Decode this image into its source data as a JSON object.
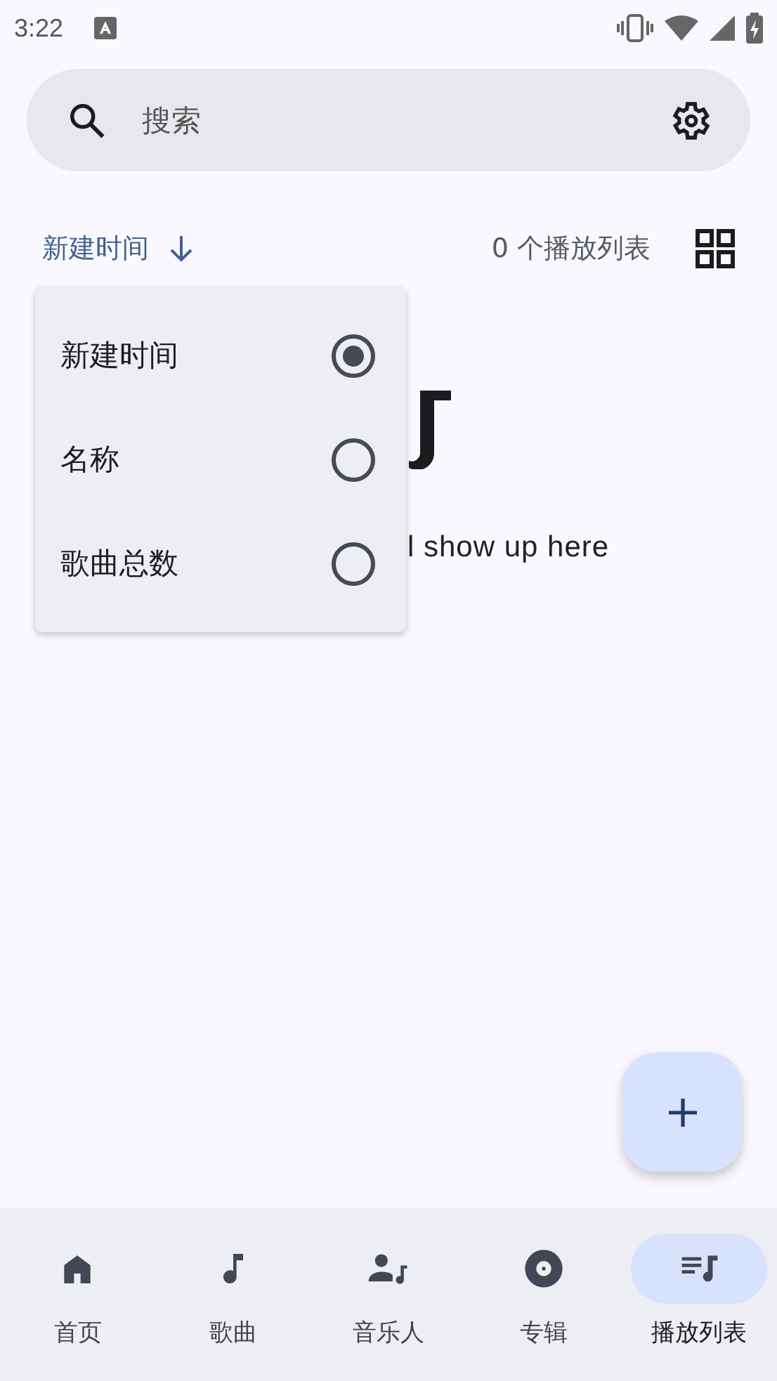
{
  "status_bar": {
    "time": "3:22"
  },
  "search": {
    "placeholder": "搜索"
  },
  "sort": {
    "label": "新建时间",
    "count": "0 个播放列表"
  },
  "sort_menu": [
    {
      "label": "新建时间",
      "selected": true
    },
    {
      "label": "名称",
      "selected": false
    },
    {
      "label": "歌曲总数",
      "selected": false
    }
  ],
  "empty_state": {
    "message": "l show up here"
  },
  "nav": [
    {
      "label": "首页",
      "kind": "home",
      "selected": false
    },
    {
      "label": "歌曲",
      "kind": "note",
      "selected": false
    },
    {
      "label": "音乐人",
      "kind": "artist",
      "selected": false
    },
    {
      "label": "专辑",
      "kind": "album",
      "selected": false
    },
    {
      "label": "播放列表",
      "kind": "playlist",
      "selected": true
    }
  ]
}
